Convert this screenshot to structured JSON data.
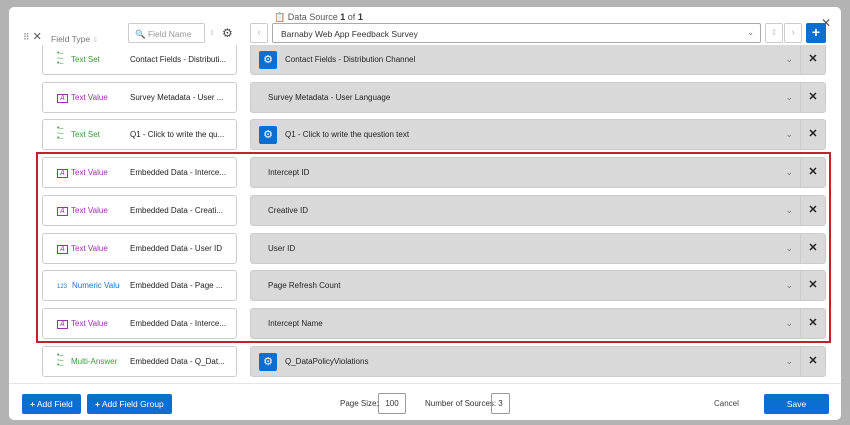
{
  "header": {
    "data_source_label": "Data Source",
    "current": "1",
    "of": "of",
    "total": "1",
    "field_type": "Field Type",
    "field_name_placeholder": "Field Name",
    "survey": "Barnaby Web App Feedback Survey"
  },
  "rows": [
    {
      "type": "Text Set",
      "kind": "set",
      "name": "Contact Fields - Distributi...",
      "value": "Contact Fields - Distribution Channel",
      "gear": true
    },
    {
      "type": "Text Value",
      "kind": "value",
      "name": "Survey Metadata - User ...",
      "value": "Survey Metadata - User Language",
      "gear": false
    },
    {
      "type": "Text Set",
      "kind": "set",
      "name": "Q1 - Click to write the qu...",
      "value": "Q1 - Click to write the question text",
      "gear": true
    },
    {
      "type": "Text Value",
      "kind": "value",
      "name": "Embedded Data - Interce...",
      "value": "Intercept ID",
      "gear": false
    },
    {
      "type": "Text Value",
      "kind": "value",
      "name": "Embedded Data - Creati...",
      "value": "Creative ID",
      "gear": false
    },
    {
      "type": "Text Value",
      "kind": "value",
      "name": "Embedded Data - User ID",
      "value": "User ID",
      "gear": false
    },
    {
      "type": "Numeric Value",
      "kind": "num",
      "name": "Embedded Data - Page ...",
      "value": "Page Refresh Count",
      "gear": false
    },
    {
      "type": "Text Value",
      "kind": "value",
      "name": "Embedded Data - Interce...",
      "value": "Intercept Name",
      "gear": false
    },
    {
      "type": "Multi-Answer",
      "kind": "set",
      "name": "Embedded Data - Q_Dat...",
      "value": "Q_DataPolicyViolations",
      "gear": true
    }
  ],
  "footer": {
    "add_field": "Add Field",
    "add_field_group": "Add Field Group",
    "page_size_label": "Page Size:",
    "page_size": "100",
    "sources_label": "Number of Sources:",
    "sources": "3",
    "cancel": "Cancel",
    "save": "Save"
  },
  "colors": {
    "accent": "#0b6ed1",
    "highlight": "#c0232f",
    "set": "#3a9a3a",
    "value": "#9b2fae",
    "num": "#1a73c9"
  }
}
